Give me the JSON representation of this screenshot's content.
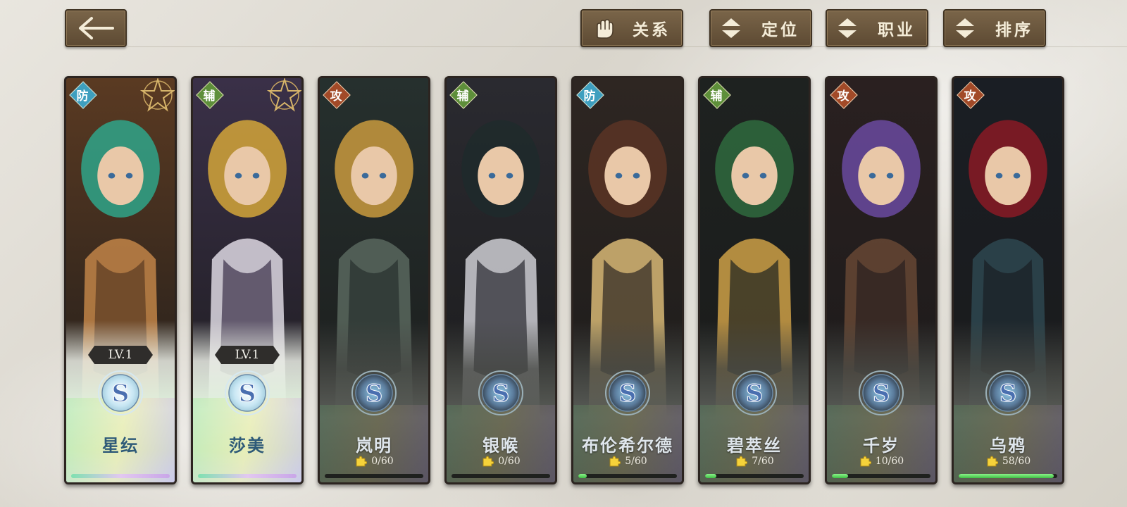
{
  "toolbar": {
    "relation_label": "关系",
    "position_label": "定位",
    "class_label": "职业",
    "sort_label": "排序"
  },
  "characters": [
    {
      "name": "星纭",
      "role": "防",
      "role_type": "def",
      "owned": true,
      "level": "LV.1",
      "rank": "S",
      "star": true
    },
    {
      "name": "莎美",
      "role": "辅",
      "role_type": "sup",
      "owned": true,
      "level": "LV.1",
      "rank": "S",
      "star": true
    },
    {
      "name": "岚明",
      "role": "攻",
      "role_type": "atk",
      "owned": false,
      "shards": "0/60",
      "progress": 0.0,
      "rank": "S"
    },
    {
      "name": "银喉",
      "role": "辅",
      "role_type": "sup",
      "owned": false,
      "shards": "0/60",
      "progress": 0.0,
      "rank": "S"
    },
    {
      "name": "布伦希尔德",
      "role": "防",
      "role_type": "def",
      "owned": false,
      "shards": "5/60",
      "progress": 0.083,
      "rank": "S"
    },
    {
      "name": "碧萃丝",
      "role": "辅",
      "role_type": "sup",
      "owned": false,
      "shards": "7/60",
      "progress": 0.117,
      "rank": "S"
    },
    {
      "name": "千岁",
      "role": "攻",
      "role_type": "atk",
      "owned": false,
      "shards": "10/60",
      "progress": 0.167,
      "rank": "S"
    },
    {
      "name": "乌鸦",
      "role": "攻",
      "role_type": "atk",
      "owned": false,
      "shards": "58/60",
      "progress": 0.967,
      "rank": "S"
    }
  ],
  "colors": {
    "button_bg": "#6b5740",
    "button_text": "#f4ecd8",
    "progress_fill": "#4fcf4f",
    "defense_badge": "#3e9fbf",
    "support_badge": "#5e8f3a",
    "attack_badge": "#a24a28"
  },
  "icons": {
    "back": "left-arrow-icon",
    "relation": "glove-icon",
    "filter": "up-down-arrows-icon",
    "star": "star-outline-icon",
    "shard": "puzzle-shard-icon",
    "rank": "s-rank-emblem"
  }
}
